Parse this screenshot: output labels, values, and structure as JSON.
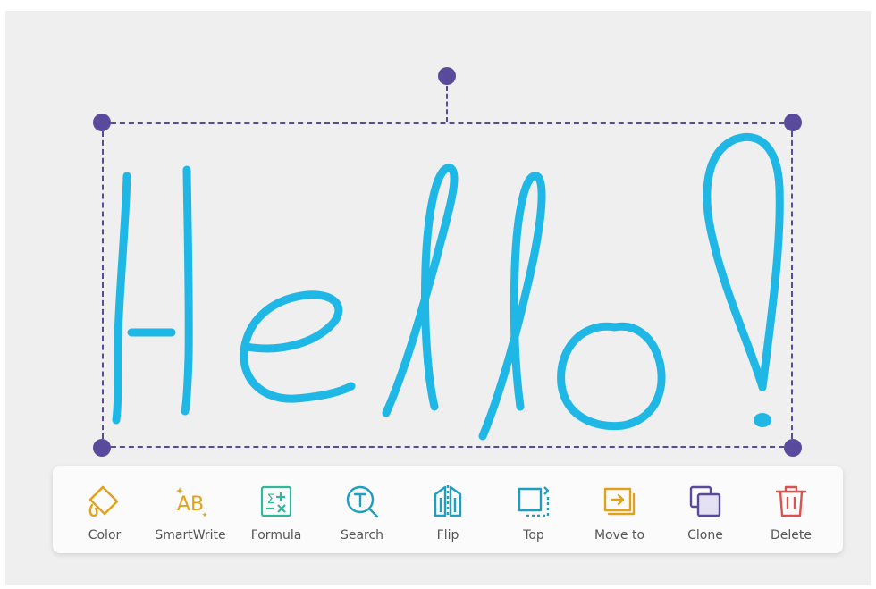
{
  "canvas": {
    "handwritten_text": "Hello!",
    "ink_color": "#1fb8e6",
    "selection_color": "#5a4a9c"
  },
  "toolbar": {
    "tools": [
      {
        "label": "Color",
        "icon": "paint-bucket-icon",
        "color": "#e0a21a"
      },
      {
        "label": "SmartWrite",
        "icon": "smart-write-icon",
        "color": "#e0a21a"
      },
      {
        "label": "Formula",
        "icon": "formula-icon",
        "color": "#2fb89a"
      },
      {
        "label": "Search",
        "icon": "search-text-icon",
        "color": "#1f9fbf"
      },
      {
        "label": "Flip",
        "icon": "flip-icon",
        "color": "#1f9fbf"
      },
      {
        "label": "Top",
        "icon": "bring-to-top-icon",
        "color": "#1f9fbf"
      },
      {
        "label": "Move to",
        "icon": "move-to-icon",
        "color": "#e0a21a"
      },
      {
        "label": "Clone",
        "icon": "clone-icon",
        "color": "#5a4a9c"
      },
      {
        "label": "Delete",
        "icon": "trash-icon",
        "color": "#d9534f"
      }
    ]
  }
}
